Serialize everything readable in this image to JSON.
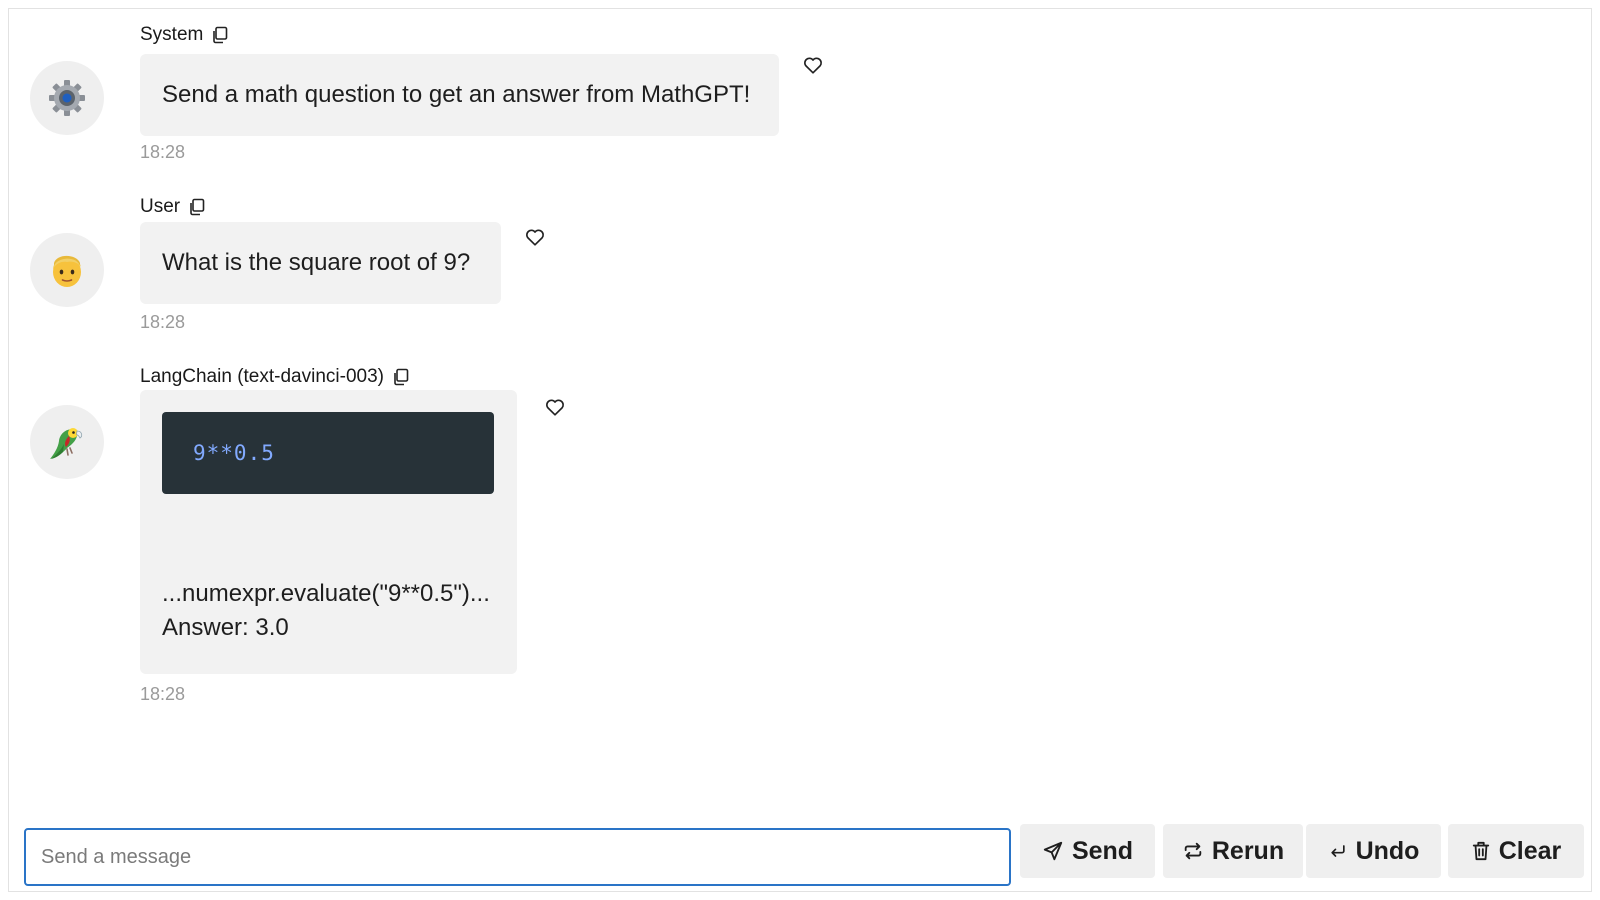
{
  "messages": [
    {
      "author": "System",
      "avatar_icon": "gear-icon",
      "text": "Send a math question to get an answer from MathGPT!",
      "time": "18:28"
    },
    {
      "author": "User",
      "avatar_icon": "person-emoji-icon",
      "text": "What is the square root of 9?",
      "time": "18:28"
    },
    {
      "author": "LangChain (text-davinci-003)",
      "avatar_icon": "parrot-icon",
      "code": "9**0.5",
      "lines": [
        "...numexpr.evaluate(\"9**0.5\")...",
        "Answer: 3.0"
      ],
      "time": "18:28"
    }
  ],
  "composer": {
    "placeholder": "Send a message",
    "value": ""
  },
  "buttons": {
    "send": "Send",
    "rerun": "Rerun",
    "undo": "Undo",
    "clear": "Clear"
  },
  "colors": {
    "input_border": "#2a74c7",
    "bubble_bg": "#f2f2f2",
    "code_bg": "#273238",
    "code_text": "#82aaff"
  }
}
